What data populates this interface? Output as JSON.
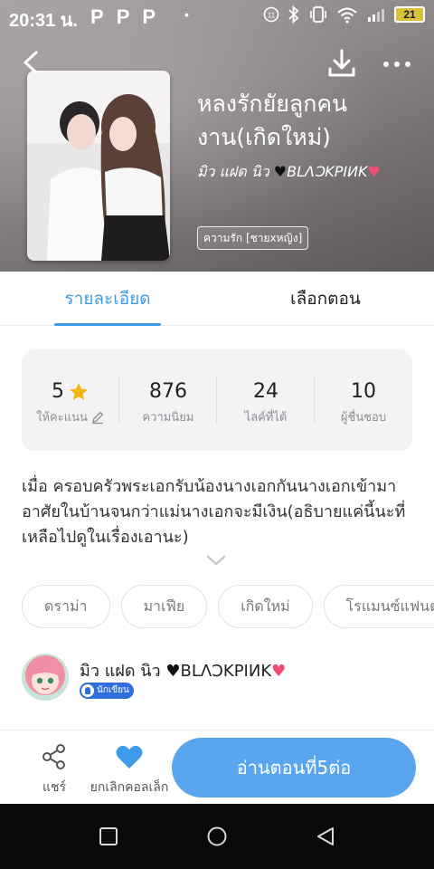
{
  "status_bar": {
    "time": "20:31 น.",
    "app_icons": [
      "P",
      "P",
      "P"
    ],
    "dot": "•",
    "battery": "21"
  },
  "novel": {
    "title": "หลงรักยัยลูกคนงาน(เกิดใหม่)",
    "author": "มิว แฝด นิว",
    "author_suffix": "BLΛƆKPIИK",
    "category_tag": "ความรัก [ชายxหญิง]"
  },
  "tabs": [
    {
      "label": "รายละเอียด",
      "active": true
    },
    {
      "label": "เลือกตอน",
      "active": false
    }
  ],
  "stats": [
    {
      "value": "5",
      "label": "ให้คะแนน",
      "icon": "star-icon"
    },
    {
      "value": "876",
      "label": "ความนิยม"
    },
    {
      "value": "24",
      "label": "ไลค์ที่ได้"
    },
    {
      "value": "10",
      "label": "ผู้ชื่นชอบ"
    }
  ],
  "description": "เมื่อ ครอบครัวพระเอกรับน้องนางเอกกันนางเอกเข้ามาอาศัยในบ้านจนกว่าแม่นางเอกจะมีเงิน(อธิบายแค่นี้นะที่เหลือไปดูในเรื่องเอานะ)",
  "genres": [
    "ดราม่า",
    "มาเฟีย",
    "เกิดใหม่",
    "โรแมนซ์แฟนตาซี"
  ],
  "writer": {
    "name": "มิว แฝด นิว",
    "suffix": "BLΛƆKPIИK",
    "badge": "นักเขียน"
  },
  "actions": {
    "share": "แชร์",
    "favorite": "ยกเลิกคอลเล็ก",
    "read": "อ่านตอนที่5ต่อ"
  },
  "colors": {
    "accent": "#3d9bea",
    "read_button": "#5aa6ee",
    "star": "#f5b40f",
    "heart": "#3d9bea"
  }
}
